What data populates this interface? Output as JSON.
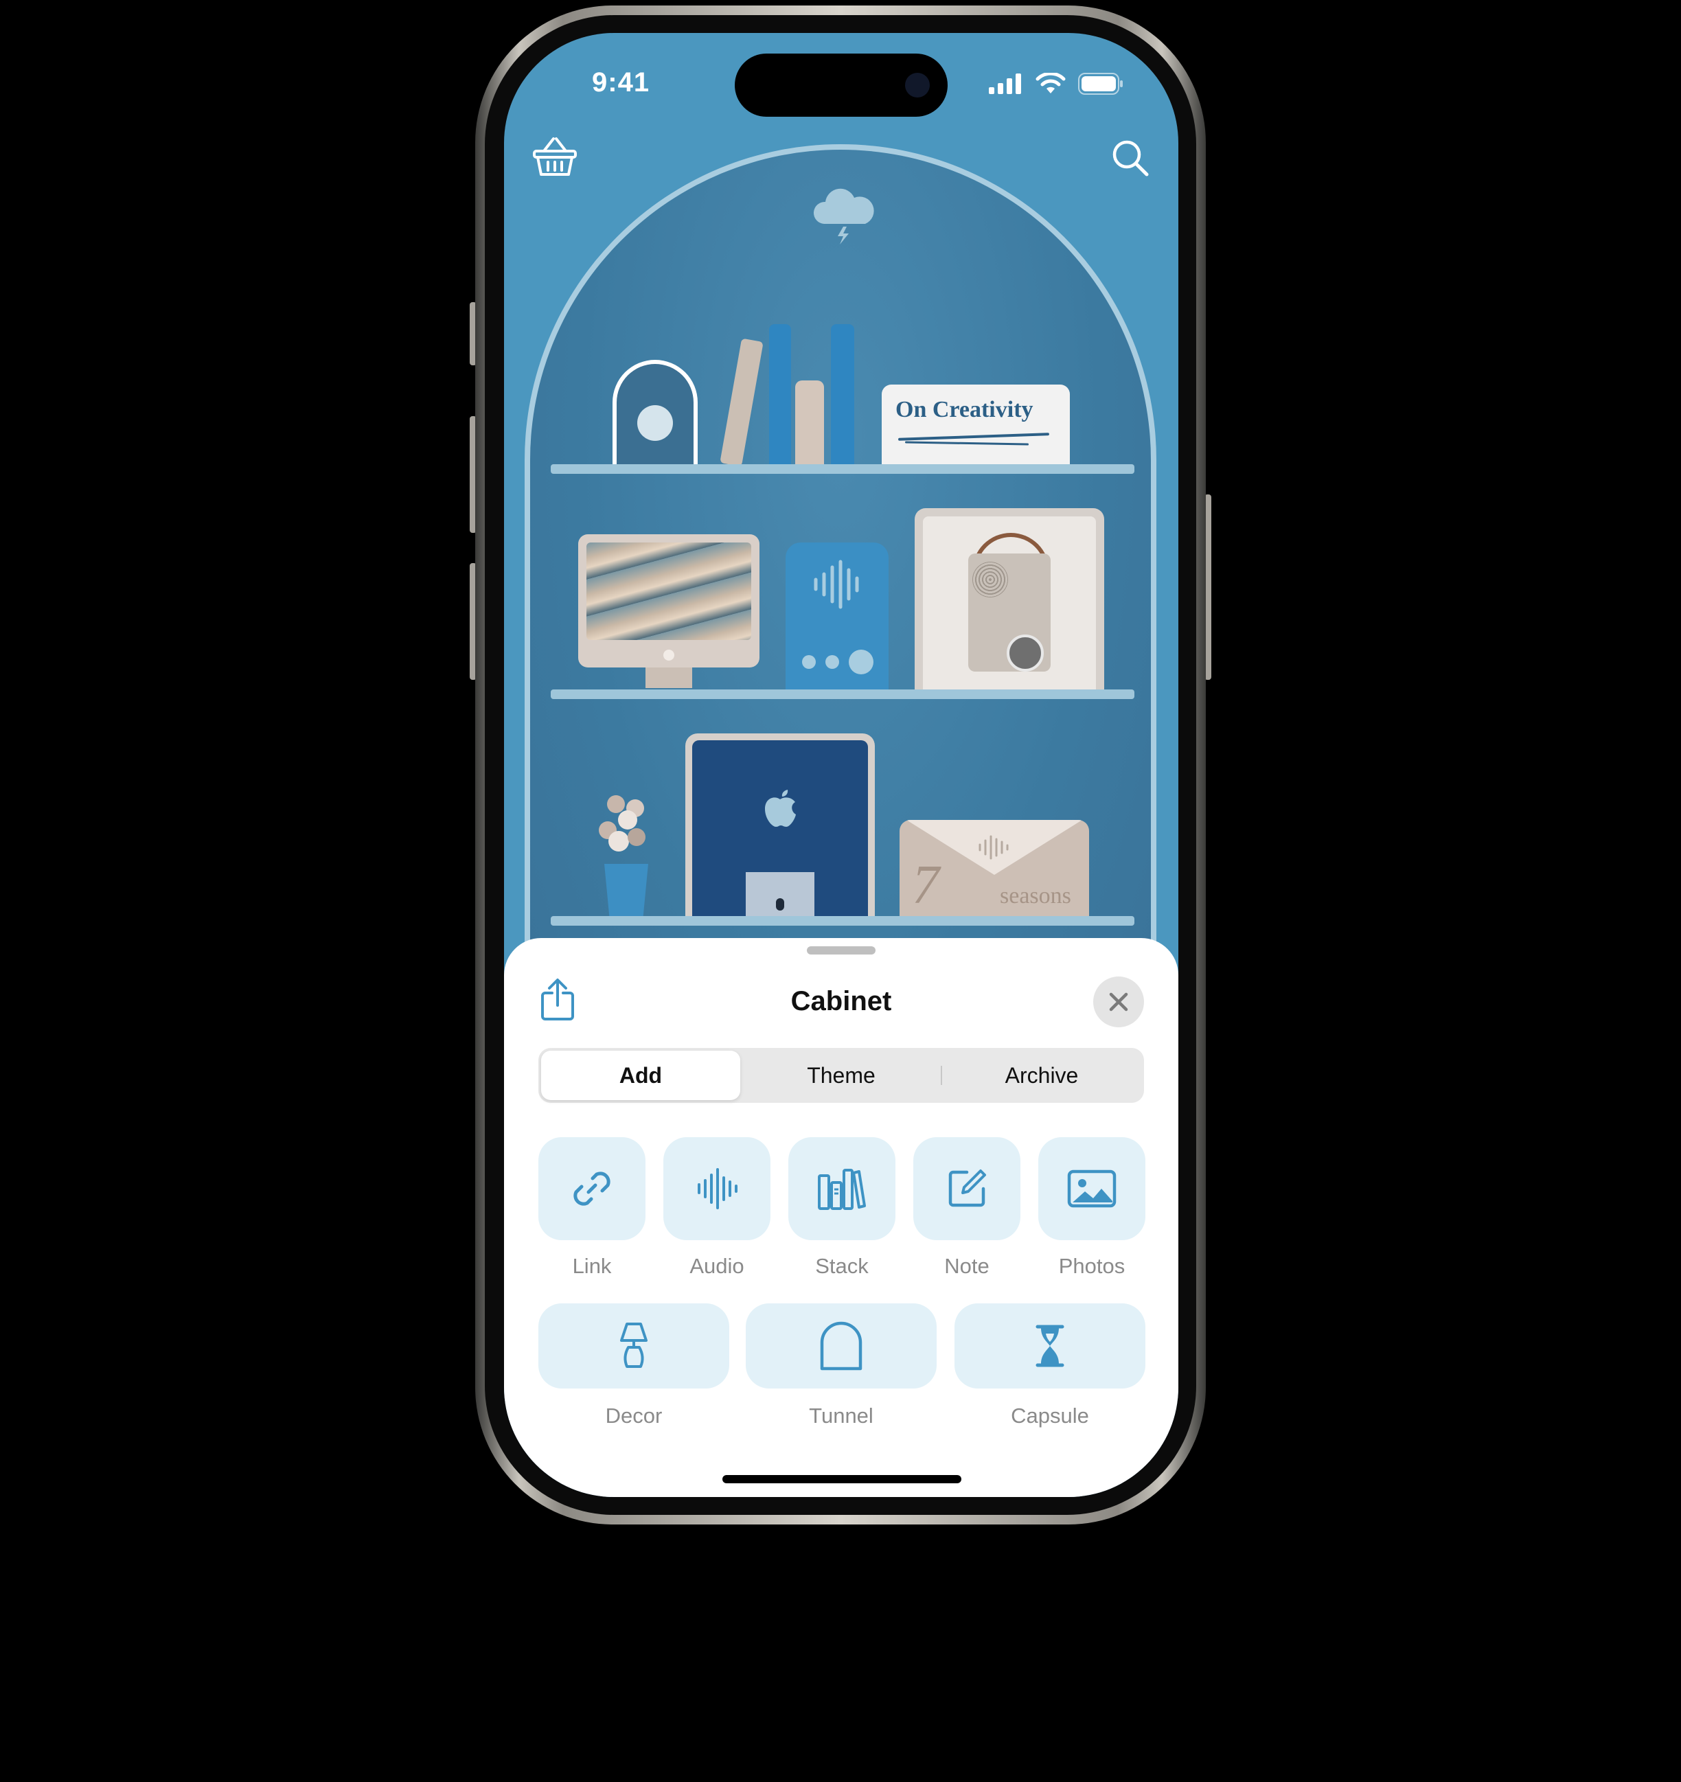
{
  "status": {
    "time": "9:41"
  },
  "shelf": {
    "book_title": "On Creativity",
    "envelope_number": "7",
    "envelope_word": "seasons"
  },
  "sheet": {
    "title": "Cabinet",
    "tabs": [
      {
        "label": "Add",
        "active": true
      },
      {
        "label": "Theme",
        "active": false
      },
      {
        "label": "Archive",
        "active": false
      }
    ],
    "row1": [
      {
        "label": "Link",
        "icon": "link-icon"
      },
      {
        "label": "Audio",
        "icon": "waveform-icon"
      },
      {
        "label": "Stack",
        "icon": "books-icon"
      },
      {
        "label": "Note",
        "icon": "note-icon"
      },
      {
        "label": "Photos",
        "icon": "photo-icon"
      }
    ],
    "row2": [
      {
        "label": "Decor",
        "icon": "lamp-icon"
      },
      {
        "label": "Tunnel",
        "icon": "arch-icon"
      },
      {
        "label": "Capsule",
        "icon": "hourglass-icon"
      }
    ]
  },
  "colors": {
    "accent": "#3e93c4",
    "tile_bg": "#e2f1f8",
    "screen_bg": "#4b97bf"
  }
}
